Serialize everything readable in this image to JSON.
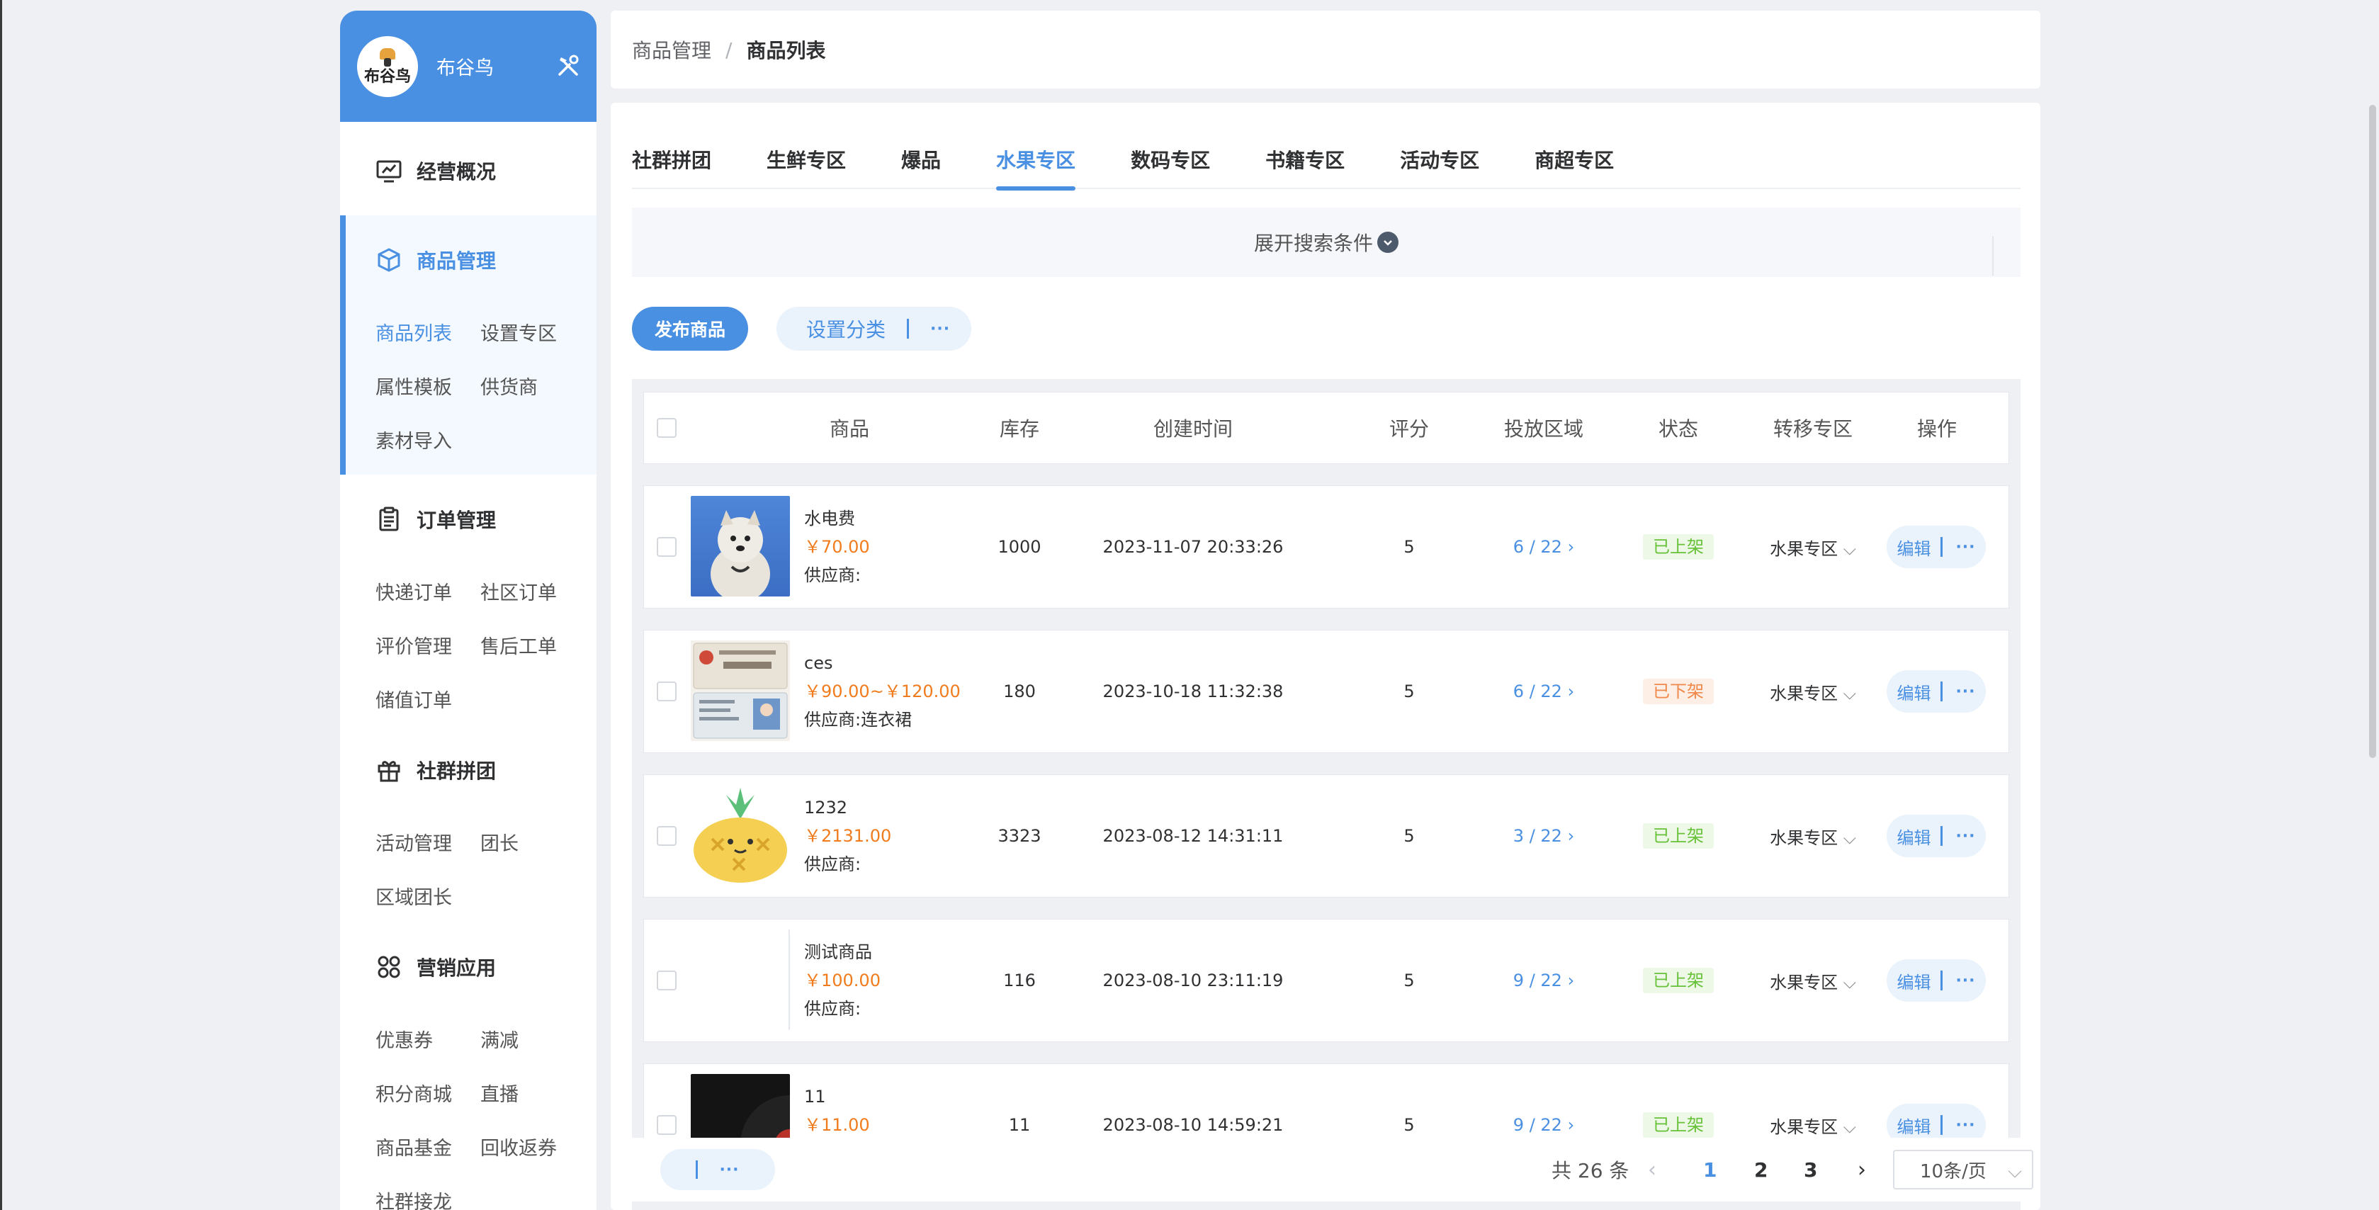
{
  "sidebar": {
    "shop_name": "布谷鸟",
    "avatar_text": "布谷鸟",
    "overview": "经营概况",
    "goods": {
      "title": "商品管理",
      "items": [
        "商品列表",
        "设置专区",
        "属性模板",
        "供货商",
        "素材导入"
      ]
    },
    "orders": {
      "title": "订单管理",
      "items": [
        "快递订单",
        "社区订单",
        "评价管理",
        "售后工单",
        "储值订单"
      ]
    },
    "group_buy": {
      "title": "社群拼团",
      "items": [
        "活动管理",
        "团长",
        "区域团长"
      ]
    },
    "marketing": {
      "title": "营销应用",
      "items": [
        "优惠券",
        "满减",
        "积分商城",
        "直播",
        "商品基金",
        "回收返券",
        "社群接龙"
      ]
    }
  },
  "breadcrumb": {
    "parent": "商品管理",
    "separator": "/",
    "current": "商品列表"
  },
  "tabs": [
    "社群拼团",
    "生鲜专区",
    "爆品",
    "水果专区",
    "数码专区",
    "书籍专区",
    "活动专区",
    "商超专区"
  ],
  "active_tab": "水果专区",
  "search_toggle": "展开搜索条件",
  "actions": {
    "publish": "发布商品",
    "set_category": "设置分类",
    "more": "···"
  },
  "table": {
    "headers": [
      "商品",
      "库存",
      "创建时间",
      "评分",
      "投放区域",
      "状态",
      "转移专区",
      "操作"
    ],
    "rows": [
      {
        "name": "水电费",
        "price": "￥70.00",
        "supplier": "供应商:",
        "stock": "1000",
        "created": "2023-11-07 20:33:26",
        "score": "5",
        "area": "6 / 22",
        "status": "已上架",
        "status_type": "on",
        "move": "水果专区",
        "edit": "编辑",
        "more": "···"
      },
      {
        "name": "ces",
        "price": "￥90.00~￥120.00",
        "supplier": "供应商:连衣裙",
        "stock": "180",
        "created": "2023-10-18 11:32:38",
        "score": "5",
        "area": "6 / 22",
        "status": "已下架",
        "status_type": "off",
        "move": "水果专区",
        "edit": "编辑",
        "more": "···"
      },
      {
        "name": "1232",
        "price": "￥2131.00",
        "supplier": "供应商:",
        "stock": "3323",
        "created": "2023-08-12 14:31:11",
        "score": "5",
        "area": "3 / 22",
        "status": "已上架",
        "status_type": "on",
        "move": "水果专区",
        "edit": "编辑",
        "more": "···"
      },
      {
        "name": "测试商品",
        "price": "￥100.00",
        "supplier": "供应商:",
        "stock": "116",
        "created": "2023-08-10 23:11:19",
        "score": "5",
        "area": "9 / 22",
        "status": "已上架",
        "status_type": "on",
        "move": "水果专区",
        "edit": "编辑",
        "more": "···"
      },
      {
        "name": "11",
        "price": "￥11.00",
        "supplier": "",
        "stock": "11",
        "created": "2023-08-10 14:59:21",
        "score": "5",
        "area": "9 / 22",
        "status": "已上架",
        "status_type": "on",
        "move": "水果专区",
        "edit": "编辑",
        "more": "···"
      }
    ]
  },
  "pagination": {
    "total": "共 26 条",
    "pages": [
      "1",
      "2",
      "3"
    ],
    "current": "1",
    "page_size": "10条/页",
    "bulk_more": "···"
  },
  "colors": {
    "primary": "#4a90e2",
    "price": "#f07c1e",
    "on_shelf": "#67c23a",
    "off_shelf": "#f0884a"
  }
}
